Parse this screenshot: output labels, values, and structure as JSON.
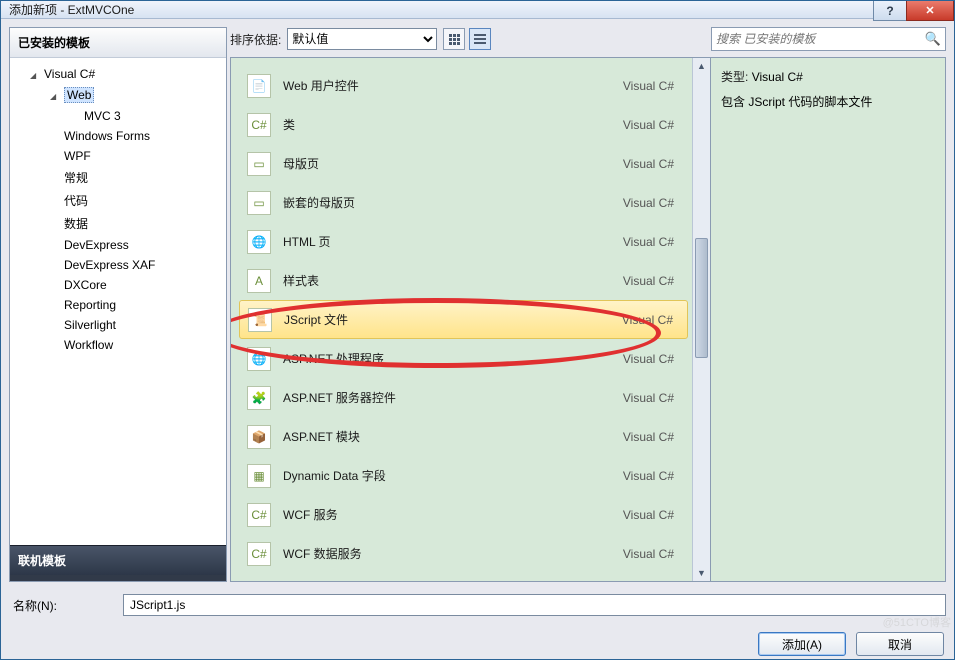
{
  "window": {
    "title": "添加新项 - ExtMVCOne"
  },
  "sidebar": {
    "installed_header": "已安装的模板",
    "online_header": "联机模板",
    "tree": [
      {
        "label": "Visual C#",
        "level": 1,
        "arrow": "open",
        "sel": false
      },
      {
        "label": "Web",
        "level": 2,
        "arrow": "open",
        "sel": true
      },
      {
        "label": "MVC 3",
        "level": 3,
        "arrow": "none",
        "sel": false
      },
      {
        "label": "Windows Forms",
        "level": 2,
        "arrow": "none",
        "sel": false
      },
      {
        "label": "WPF",
        "level": 2,
        "arrow": "none",
        "sel": false
      },
      {
        "label": "常规",
        "level": 2,
        "arrow": "none",
        "sel": false
      },
      {
        "label": "代码",
        "level": 2,
        "arrow": "none",
        "sel": false
      },
      {
        "label": "数据",
        "level": 2,
        "arrow": "none",
        "sel": false
      },
      {
        "label": "DevExpress",
        "level": 2,
        "arrow": "none",
        "sel": false
      },
      {
        "label": "DevExpress XAF",
        "level": 2,
        "arrow": "none",
        "sel": false
      },
      {
        "label": "DXCore",
        "level": 2,
        "arrow": "none",
        "sel": false
      },
      {
        "label": "Reporting",
        "level": 2,
        "arrow": "none",
        "sel": false
      },
      {
        "label": "Silverlight",
        "level": 2,
        "arrow": "none",
        "sel": false
      },
      {
        "label": "Workflow",
        "level": 2,
        "arrow": "none",
        "sel": false
      }
    ]
  },
  "toolbar": {
    "sort_label": "排序依据:",
    "sort_value": "默认值",
    "search_placeholder": "搜索 已安装的模板"
  },
  "items": [
    {
      "icon": "📄",
      "label": "Web 用户控件",
      "cat": "Visual C#",
      "sel": false
    },
    {
      "icon": "C#",
      "label": "类",
      "cat": "Visual C#",
      "sel": false
    },
    {
      "icon": "▭",
      "label": "母版页",
      "cat": "Visual C#",
      "sel": false
    },
    {
      "icon": "▭",
      "label": "嵌套的母版页",
      "cat": "Visual C#",
      "sel": false
    },
    {
      "icon": "🌐",
      "label": "HTML 页",
      "cat": "Visual C#",
      "sel": false
    },
    {
      "icon": "A",
      "label": "样式表",
      "cat": "Visual C#",
      "sel": false
    },
    {
      "icon": "📜",
      "label": "JScript 文件",
      "cat": "Visual C#",
      "sel": true
    },
    {
      "icon": "🌐",
      "label": "ASP.NET 处理程序",
      "cat": "Visual C#",
      "sel": false
    },
    {
      "icon": "🧩",
      "label": "ASP.NET 服务器控件",
      "cat": "Visual C#",
      "sel": false
    },
    {
      "icon": "📦",
      "label": "ASP.NET 模块",
      "cat": "Visual C#",
      "sel": false
    },
    {
      "icon": "▦",
      "label": "Dynamic Data 字段",
      "cat": "Visual C#",
      "sel": false
    },
    {
      "icon": "C#",
      "label": "WCF 服务",
      "cat": "Visual C#",
      "sel": false
    },
    {
      "icon": "C#",
      "label": "WCF 数据服务",
      "cat": "Visual C#",
      "sel": false
    }
  ],
  "detail": {
    "type_label": "类型:",
    "type_value": "Visual C#",
    "desc": "包含 JScript 代码的脚本文件"
  },
  "name": {
    "label": "名称(N):",
    "value": "JScript1.js"
  },
  "buttons": {
    "add": "添加(A)",
    "cancel": "取消"
  },
  "watermark": "@51CTO博客"
}
